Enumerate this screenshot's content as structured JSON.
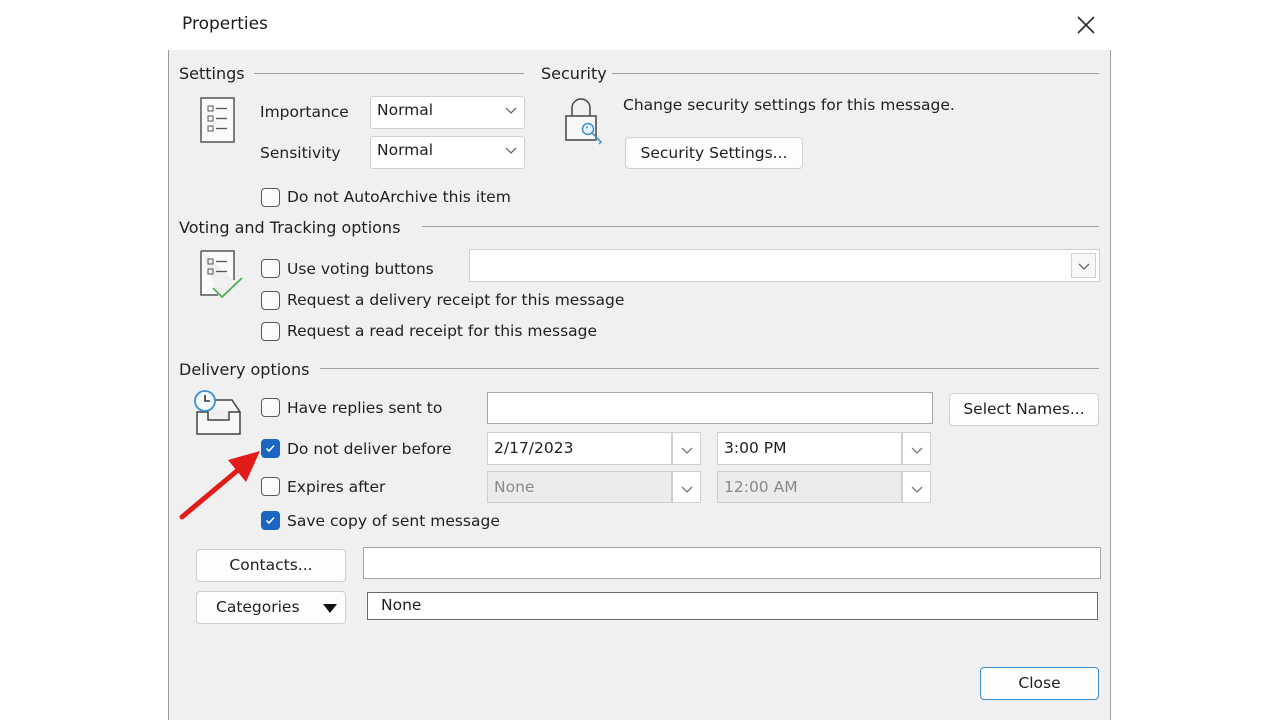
{
  "window": {
    "title": "Properties",
    "close_icon": "close-icon"
  },
  "settings": {
    "heading": "Settings",
    "importance_label": "Importance",
    "importance_value": "Normal",
    "sensitivity_label": "Sensitivity",
    "sensitivity_value": "Normal",
    "autoarchive_label": "Do not AutoArchive this item",
    "autoarchive_checked": false
  },
  "security": {
    "heading": "Security",
    "description": "Change security settings for this message.",
    "button_label": "Security Settings..."
  },
  "voting": {
    "heading": "Voting and Tracking options",
    "use_voting_label": "Use voting buttons",
    "use_voting_checked": false,
    "voting_value": "",
    "delivery_receipt_label": "Request a delivery receipt for this message",
    "delivery_receipt_checked": false,
    "read_receipt_label": "Request a read receipt for this message",
    "read_receipt_checked": false
  },
  "delivery": {
    "heading": "Delivery options",
    "replies_label": "Have replies sent to",
    "replies_checked": false,
    "replies_value": "",
    "select_names_label": "Select Names...",
    "deliver_before_label": "Do not deliver before",
    "deliver_before_checked": true,
    "deliver_before_date": "2/17/2023",
    "deliver_before_time": "3:00 PM",
    "expires_label": "Expires after",
    "expires_checked": false,
    "expires_date": "None",
    "expires_time": "12:00 AM",
    "save_copy_label": "Save copy of sent message",
    "save_copy_checked": true
  },
  "footer": {
    "contacts_label": "Contacts...",
    "contacts_value": "",
    "categories_label": "Categories",
    "categories_value": "None",
    "close_label": "Close"
  },
  "annotation": {
    "arrow_color": "#e21b1b"
  },
  "colors": {
    "accent": "#1a66c0",
    "close_button_border": "#3d8fd6"
  }
}
